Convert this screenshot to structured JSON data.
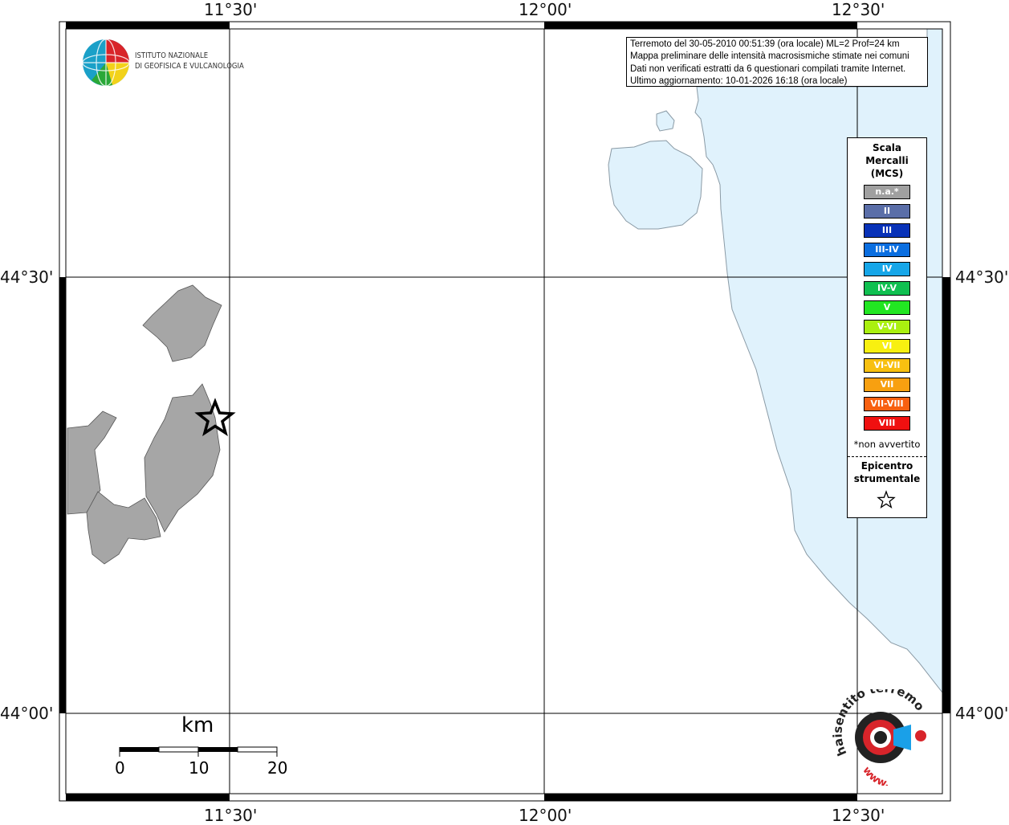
{
  "axes": {
    "top_labels": [
      "11°30'",
      "12°00'",
      "12°30'"
    ],
    "bottom_labels": [
      "11°30'",
      "12°00'",
      "12°30'"
    ],
    "left_labels": [
      "44°30'",
      "44°00'"
    ],
    "right_labels": [
      "44°30'",
      "44°00'"
    ]
  },
  "info": {
    "line1": "Terremoto del 30-05-2010 00:51:39 (ora locale) ML=2 Prof=24 km",
    "line2": "Mappa preliminare delle intensità macrosismiche stimate nei comuni",
    "line3": "Dati non verificati estratti da 6 questionari compilati tramite Internet.",
    "line4": "Ultimo aggiornamento: 10-01-2026 16:18 (ora locale)"
  },
  "ingv": {
    "line1": "ISTITUTO NAZIONALE",
    "line2": "DI GEOFISICA E VULCANOLOGIA"
  },
  "legend": {
    "title1": "Scala",
    "title2": "Mercalli",
    "title3": "(MCS)",
    "items": [
      {
        "label": "n.a.*",
        "color": "#a0a0a0"
      },
      {
        "label": "II",
        "color": "#5a6ea8"
      },
      {
        "label": "III",
        "color": "#0832b8"
      },
      {
        "label": "III-IV",
        "color": "#0a6ee0"
      },
      {
        "label": "IV",
        "color": "#16a6e8"
      },
      {
        "label": "IV-V",
        "color": "#10c050"
      },
      {
        "label": "V",
        "color": "#22e622"
      },
      {
        "label": "V-VI",
        "color": "#aaf010"
      },
      {
        "label": "VI",
        "color": "#f8f010"
      },
      {
        "label": "VI-VII",
        "color": "#f8c010"
      },
      {
        "label": "VII",
        "color": "#f8a010"
      },
      {
        "label": "VII-VIII",
        "color": "#f86010"
      },
      {
        "label": "VIII",
        "color": "#f01010"
      }
    ],
    "note": "*non avvertito",
    "epicentro1": "Epicentro",
    "epicentro2": "strumentale"
  },
  "scale": {
    "title": "km",
    "ticks": [
      "0",
      "10",
      "20"
    ]
  },
  "colors": {
    "sea": "#e0f2fc",
    "municipality": "#a6a6a6"
  }
}
